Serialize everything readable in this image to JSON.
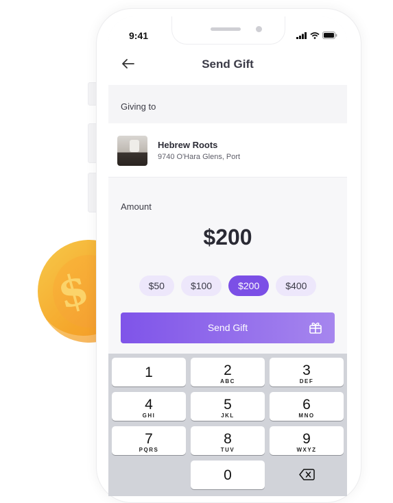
{
  "status_bar": {
    "time": "9:41"
  },
  "header": {
    "title": "Send Gift"
  },
  "recipient_section": {
    "label": "Giving to"
  },
  "recipient": {
    "name": "Hebrew Roots",
    "address": "9740 O'Hara Glens, Port"
  },
  "amount_section": {
    "label": "Amount",
    "value": "$200"
  },
  "preset_amounts": [
    {
      "label": "$50",
      "selected": false
    },
    {
      "label": "$100",
      "selected": false
    },
    {
      "label": "$200",
      "selected": true
    },
    {
      "label": "$400",
      "selected": false
    }
  ],
  "send_button": {
    "label": "Send Gift"
  },
  "keypad": {
    "keys": [
      {
        "number": "1",
        "letters": ""
      },
      {
        "number": "2",
        "letters": "ABC"
      },
      {
        "number": "3",
        "letters": "DEF"
      },
      {
        "number": "4",
        "letters": "GHI"
      },
      {
        "number": "5",
        "letters": "JKL"
      },
      {
        "number": "6",
        "letters": "MNO"
      },
      {
        "number": "7",
        "letters": "PQRS"
      },
      {
        "number": "8",
        "letters": "TUV"
      },
      {
        "number": "9",
        "letters": "WXYZ"
      },
      {
        "number": "0",
        "letters": ""
      }
    ]
  },
  "colors": {
    "accent": "#7b4fe6",
    "chip_bg": "#ede7fb",
    "coin": "#f5a62b"
  }
}
